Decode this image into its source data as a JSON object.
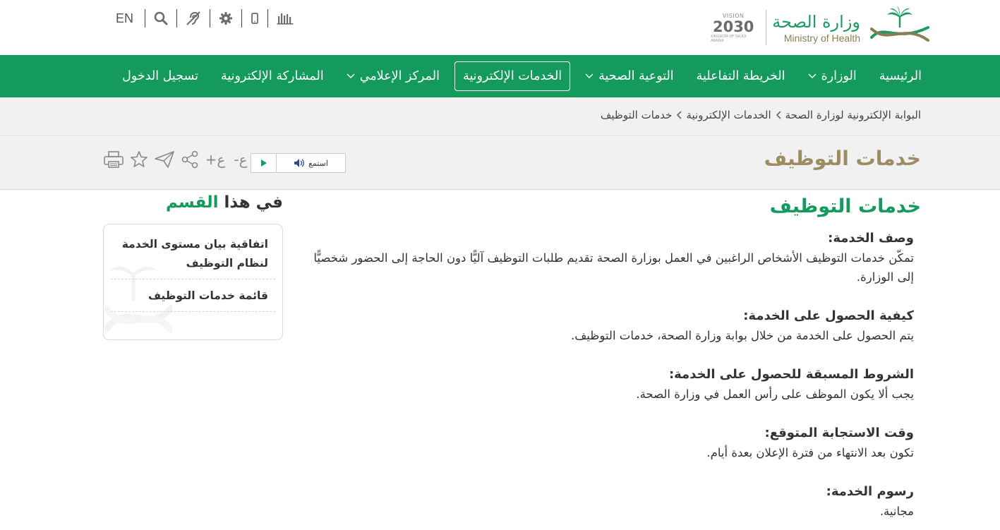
{
  "header": {
    "ministry_name_ar": "وزارة الصحة",
    "ministry_name_en": "Ministry of Health",
    "vision_top": "VISION",
    "vision_number": "2030",
    "vision_sub": "KINGDOM OF SAUDI ARABIA",
    "language_toggle": "EN",
    "tool_icons": [
      "stats-icon",
      "mobile-icon",
      "settings-gear-icon",
      "accessibility-hearing-icon",
      "search-icon"
    ]
  },
  "nav": {
    "items": [
      {
        "label": "الرئيسية",
        "has_dropdown": false,
        "active": false
      },
      {
        "label": "الوزارة",
        "has_dropdown": true,
        "active": false
      },
      {
        "label": "الخريطة التفاعلية",
        "has_dropdown": false,
        "active": false
      },
      {
        "label": "التوعية الصحية",
        "has_dropdown": true,
        "active": false
      },
      {
        "label": "الخدمات الإلكترونية",
        "has_dropdown": false,
        "active": true
      },
      {
        "label": "المركز الإعلامي",
        "has_dropdown": true,
        "active": false
      },
      {
        "label": "المشاركة الإلكترونية",
        "has_dropdown": false,
        "active": false
      },
      {
        "label": "تسجيل الدخول",
        "has_dropdown": false,
        "active": false
      }
    ]
  },
  "breadcrumb": {
    "items": [
      "البوابة الإلكترونية لوزارة الصحة",
      "الخدمات الإلكترونية",
      "خدمات التوظيف"
    ]
  },
  "page": {
    "title": "خدمات التوظيف",
    "listen_label": "استمع",
    "font_increase": "+ع",
    "font_decrease": "-ع"
  },
  "content": {
    "heading": "خدمات التوظيف",
    "sections": [
      {
        "heading": "وصف الخدمة:",
        "text": "تمكّن خدمات التوظيف الأشخاص الراغبين في العمل بوزارة الصحة تقديم طلبات التوظيف آليًّا دون الحاجة إلى الحضور شخصيًّا إلى الوزارة."
      },
      {
        "heading": "كيفية الحصول على الخدمة:",
        "text": "يتم الحصول على الخدمة من خلال بوابة وزارة الصحة، خدمات التوظيف."
      },
      {
        "heading": "الشروط المسبقة للحصول على الخدمة:",
        "text": "يجب ألا يكون الموظف على رأس العمل في وزارة الصحة."
      },
      {
        "heading": "وقت الاستجابة المتوقع:",
        "text": "تكون بعد الانتهاء من فترة الإعلان بعدة أيام."
      },
      {
        "heading": "رسوم الخدمة:",
        "text": "مجانية."
      }
    ]
  },
  "sidebar": {
    "title_part1": "في هذا",
    "title_part2": "القسم",
    "items": [
      {
        "label": "اتفاقية بيان مستوى الخدمة لنظام التوظيف"
      },
      {
        "label": "قائمة خدمات التوظيف"
      }
    ]
  },
  "colors": {
    "brand_green": "#149a5d",
    "gold": "#9b8c62",
    "bar_gray": "#f1f1f1"
  }
}
